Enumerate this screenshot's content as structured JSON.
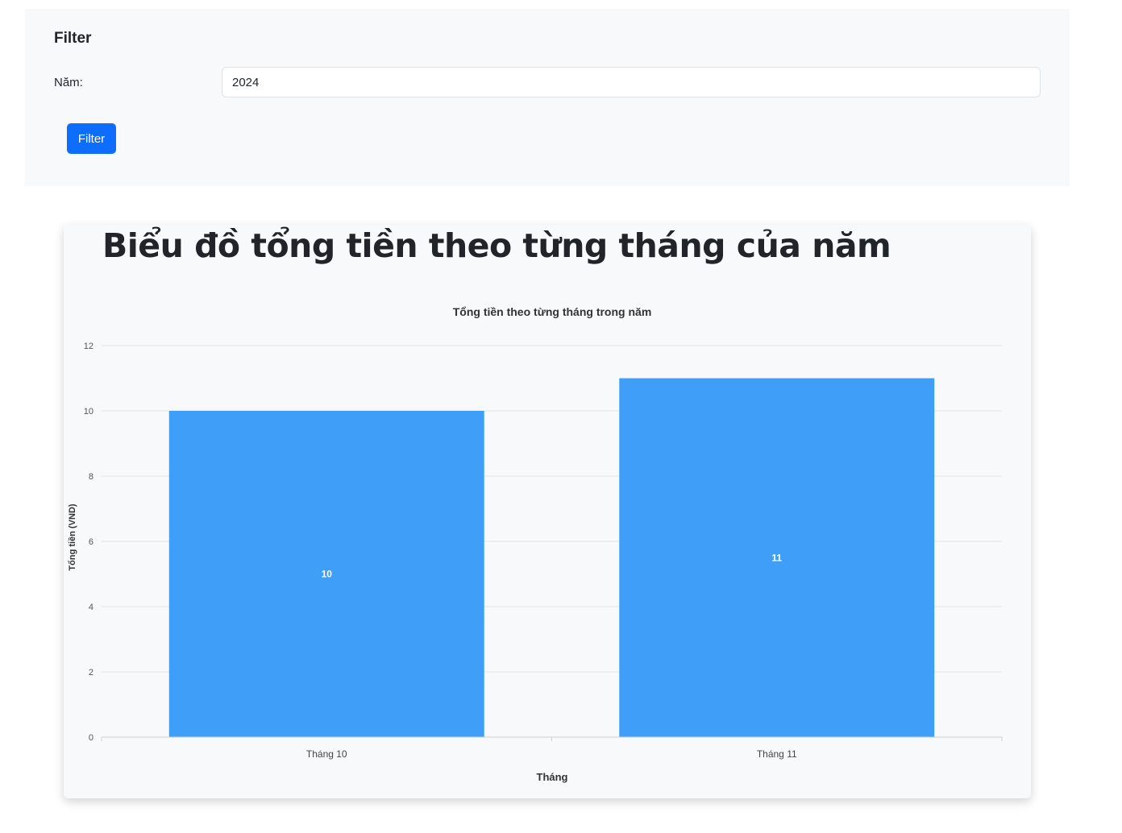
{
  "filter": {
    "title": "Filter",
    "year_label": "Năm:",
    "year_value": "2024",
    "button_label": "Filter"
  },
  "chart_section": {
    "heading": "Biểu đồ tổng tiền theo từng tháng của năm"
  },
  "colors": {
    "accent": "#0d6efd",
    "bar": "#3f9ef8",
    "panel_bg": "#f8f9fa"
  },
  "chart_data": {
    "type": "bar",
    "title": "Tổng tiền theo từng tháng trong năm",
    "xlabel": "Tháng",
    "ylabel": "Tổng tiền (VND)",
    "categories": [
      "Tháng 10",
      "Tháng 11"
    ],
    "values": [
      10,
      11
    ],
    "ylim": [
      0,
      12
    ],
    "yticks": [
      0,
      2,
      4,
      6,
      8,
      10,
      12
    ],
    "grid": true,
    "data_labels": true
  }
}
